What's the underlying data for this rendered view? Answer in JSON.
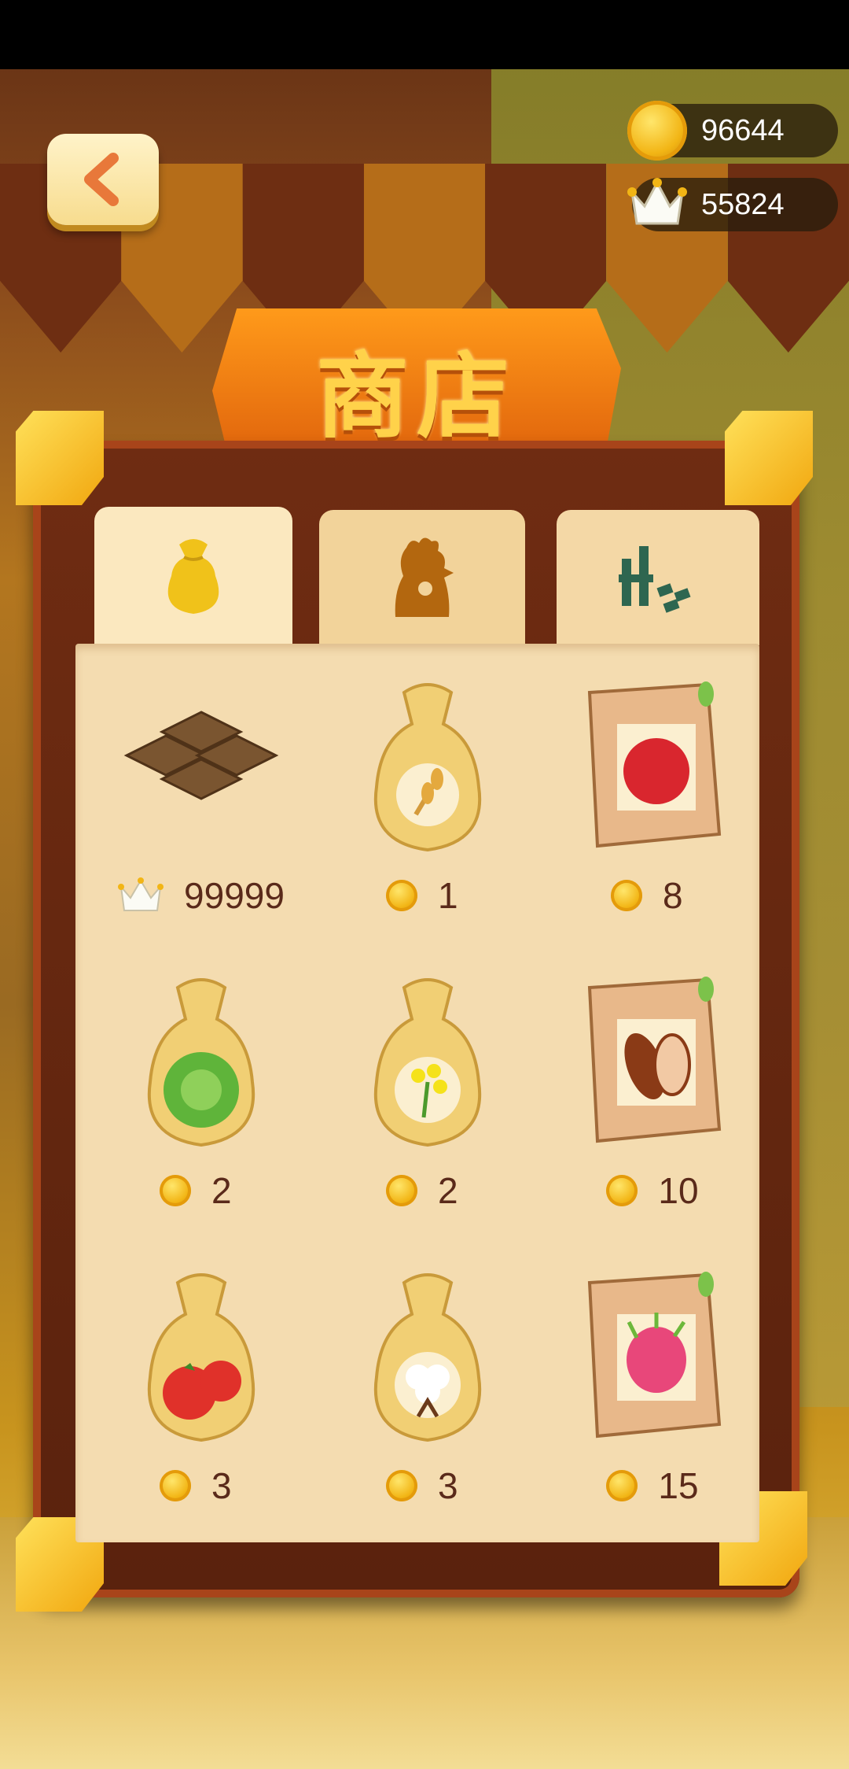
{
  "header": {
    "title": "商店",
    "coins": "96644",
    "crowns": "55824"
  },
  "tabs": [
    {
      "name": "seeds",
      "icon": "seed-bag-icon",
      "active": true
    },
    {
      "name": "animals",
      "icon": "chicken-icon",
      "active": false
    },
    {
      "name": "buildings",
      "icon": "buildings-icon",
      "active": false
    }
  ],
  "items": [
    {
      "name": "land-plot",
      "icon": "farmland-tiles-icon",
      "currency": "crown",
      "price": "99999"
    },
    {
      "name": "wheat-seed",
      "icon": "wheat-seed-bag-icon",
      "currency": "coin",
      "price": "1"
    },
    {
      "name": "apple-seed",
      "icon": "apple-seed-packet-icon",
      "currency": "coin",
      "price": "8"
    },
    {
      "name": "cabbage-seed",
      "icon": "cabbage-seed-bag-icon",
      "currency": "coin",
      "price": "2"
    },
    {
      "name": "rapeseed-seed",
      "icon": "rapeseed-flower-seed-bag-icon",
      "currency": "coin",
      "price": "2"
    },
    {
      "name": "cocoa-seed",
      "icon": "cocoa-seed-packet-icon",
      "currency": "coin",
      "price": "10"
    },
    {
      "name": "tomato-seed",
      "icon": "tomato-seed-bag-icon",
      "currency": "coin",
      "price": "3"
    },
    {
      "name": "cotton-seed",
      "icon": "cotton-seed-bag-icon",
      "currency": "coin",
      "price": "3"
    },
    {
      "name": "dragonfruit-seed",
      "icon": "dragonfruit-seed-packet-icon",
      "currency": "coin",
      "price": "15"
    }
  ],
  "colors": {
    "banner": "#f07a14",
    "title_text": "#ffd24a",
    "panel_frame": "#6f2c12",
    "panel_content": "#f4dcb0",
    "price_text": "#5a2a1a"
  }
}
